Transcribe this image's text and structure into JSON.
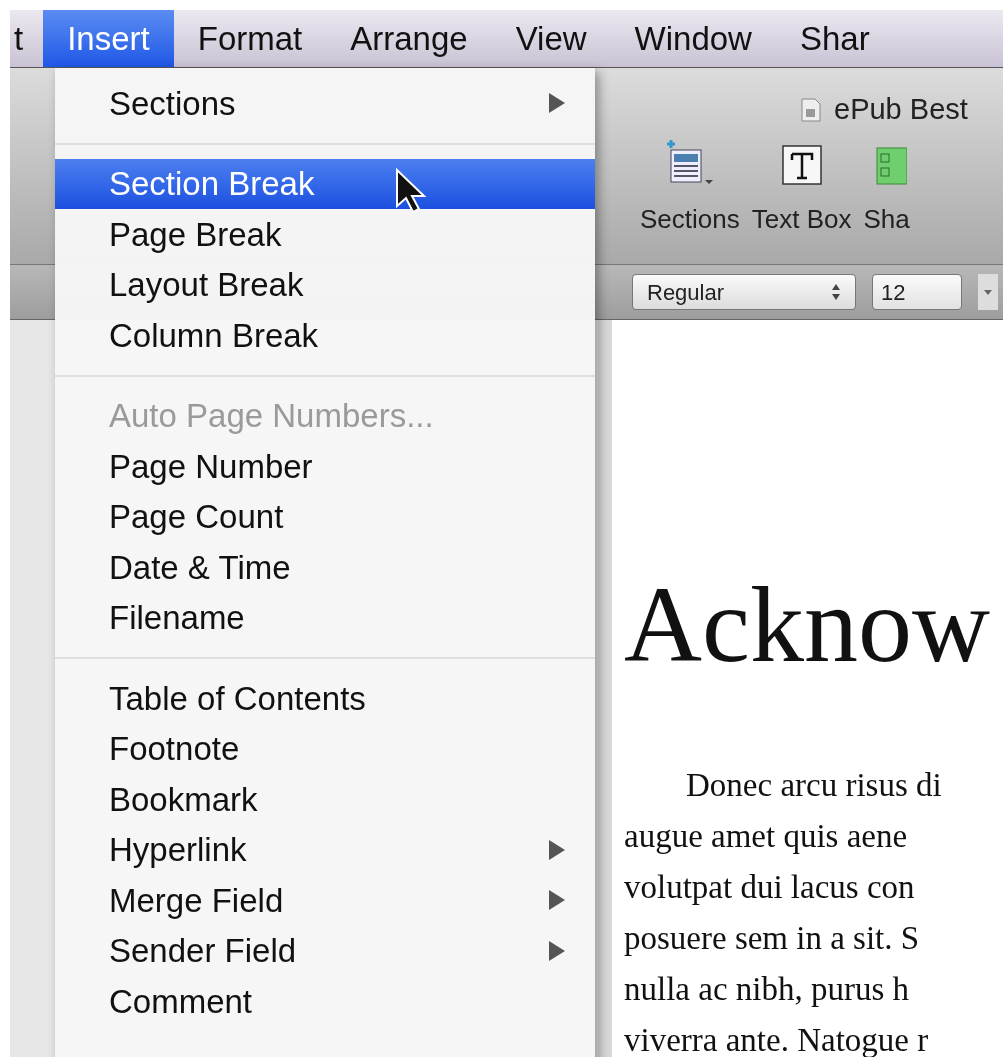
{
  "menubar": [
    {
      "label": "t",
      "selected": false
    },
    {
      "label": "Insert",
      "selected": true
    },
    {
      "label": "Format",
      "selected": false
    },
    {
      "label": "Arrange",
      "selected": false
    },
    {
      "label": "View",
      "selected": false
    },
    {
      "label": "Window",
      "selected": false
    },
    {
      "label": "Shar",
      "selected": false
    }
  ],
  "menu": [
    {
      "kind": "item",
      "label": "Sections",
      "submenu": true,
      "disabled": false,
      "selected": false
    },
    {
      "kind": "separator"
    },
    {
      "kind": "item",
      "label": "Section Break",
      "submenu": false,
      "disabled": false,
      "selected": true
    },
    {
      "kind": "item",
      "label": "Page Break",
      "submenu": false,
      "disabled": false,
      "selected": false
    },
    {
      "kind": "item",
      "label": "Layout Break",
      "submenu": false,
      "disabled": false,
      "selected": false
    },
    {
      "kind": "item",
      "label": "Column Break",
      "submenu": false,
      "disabled": false,
      "selected": false
    },
    {
      "kind": "separator"
    },
    {
      "kind": "item",
      "label": "Auto Page Numbers...",
      "submenu": false,
      "disabled": true,
      "selected": false
    },
    {
      "kind": "item",
      "label": "Page Number",
      "submenu": false,
      "disabled": false,
      "selected": false
    },
    {
      "kind": "item",
      "label": "Page Count",
      "submenu": false,
      "disabled": false,
      "selected": false
    },
    {
      "kind": "item",
      "label": "Date & Time",
      "submenu": false,
      "disabled": false,
      "selected": false
    },
    {
      "kind": "item",
      "label": "Filename",
      "submenu": false,
      "disabled": false,
      "selected": false
    },
    {
      "kind": "separator"
    },
    {
      "kind": "item",
      "label": "Table of Contents",
      "submenu": false,
      "disabled": false,
      "selected": false
    },
    {
      "kind": "item",
      "label": "Footnote",
      "submenu": false,
      "disabled": false,
      "selected": false
    },
    {
      "kind": "item",
      "label": "Bookmark",
      "submenu": false,
      "disabled": false,
      "selected": false
    },
    {
      "kind": "item",
      "label": "Hyperlink",
      "submenu": true,
      "disabled": false,
      "selected": false
    },
    {
      "kind": "item",
      "label": "Merge Field",
      "submenu": true,
      "disabled": false,
      "selected": false
    },
    {
      "kind": "item",
      "label": "Sender Field",
      "submenu": true,
      "disabled": false,
      "selected": false
    },
    {
      "kind": "item",
      "label": "Comment",
      "submenu": false,
      "disabled": false,
      "selected": false
    }
  ],
  "window": {
    "title": "ePub Best"
  },
  "toolbar": [
    {
      "label": "Sections",
      "kind": "sections"
    },
    {
      "label": "Text Box",
      "kind": "textbox"
    },
    {
      "label": "Sha",
      "kind": "shapes"
    }
  ],
  "format_bar": {
    "style": "Regular",
    "size": "12"
  },
  "document": {
    "heading": "Acknow",
    "lines": [
      "Donec arcu risus di",
      "augue amet quis aene",
      "volutpat dui lacus con",
      "posuere sem in a sit. S",
      "nulla ac nibh, purus h",
      "viverra ante. Natogue r"
    ]
  }
}
